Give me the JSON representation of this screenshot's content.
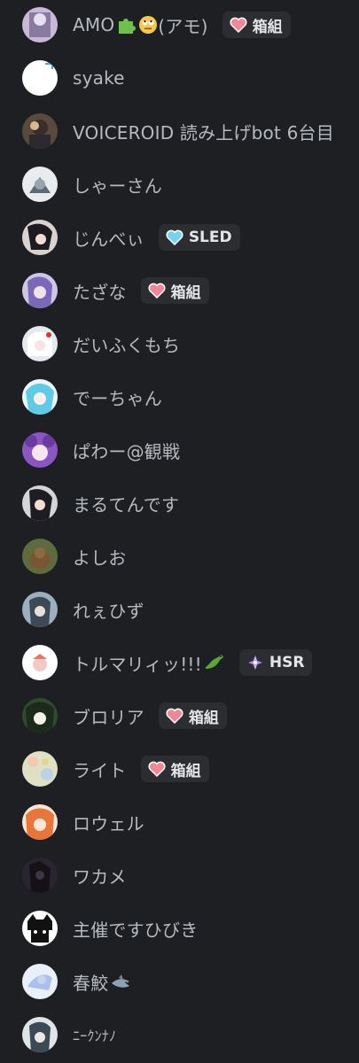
{
  "members": [
    {
      "name": "AMO",
      "suffix": "(アモ)",
      "tag": "箱組",
      "tag_icon": "heart-icon",
      "avatar_color": "#c9b8d6"
    },
    {
      "name": "syake",
      "avatar_color": "#ffffff"
    },
    {
      "name": "VOICEROID 読み上げbot 6台目",
      "avatar_color": "#5a4a3c"
    },
    {
      "name": "しゃーさん",
      "avatar_color": "#8d96a3"
    },
    {
      "name": "じんべぃ",
      "tag": "SLED",
      "tag_icon": "diamond-heart-icon",
      "avatar_color": "#d9d2cf"
    },
    {
      "name": "たざな",
      "tag": "箱組",
      "tag_icon": "heart-icon",
      "avatar_color": "#9a8fc9"
    },
    {
      "name": "だいふくもち",
      "avatar_color": "#e6e9ee"
    },
    {
      "name": "でーちゃん",
      "avatar_color": "#6fd0ea"
    },
    {
      "name": "ぱわー@観戦",
      "avatar_color": "#8c55c4"
    },
    {
      "name": "まるてんです",
      "avatar_color": "#c7c7cb"
    },
    {
      "name": "よしお",
      "avatar_color": "#5e6b3e"
    },
    {
      "name": "れぇひず",
      "avatar_color": "#9bb0bf"
    },
    {
      "name": "トルマリィッ!!!",
      "tag": "HSR",
      "tag_icon": "hsr-icon",
      "avatar_color": "#ffffff"
    },
    {
      "name": "ブロリア",
      "tag": "箱組",
      "tag_icon": "heart-icon",
      "avatar_color": "#2f4a2c"
    },
    {
      "name": "ライト",
      "tag": "箱組",
      "tag_icon": "heart-icon",
      "avatar_color": "#dfe0c4"
    },
    {
      "name": "ロウェル",
      "avatar_color": "#e8763a"
    },
    {
      "name": "ワカメ",
      "avatar_color": "#2a2430"
    },
    {
      "name": "主催ですひびき",
      "avatar_color": "#ffffff"
    },
    {
      "name": "春鮫",
      "avatar_color": "#c5d4ef"
    },
    {
      "name": "ﾆｰｸﾝﾅﾉ",
      "avatar_color": "#7c8a95"
    }
  ],
  "colors": {
    "background": "#1e1f22",
    "name_text": "#b5bac1",
    "tag_bg": "#2b2d31",
    "heart": "#f08696",
    "diamond": "#6fd6f2"
  }
}
